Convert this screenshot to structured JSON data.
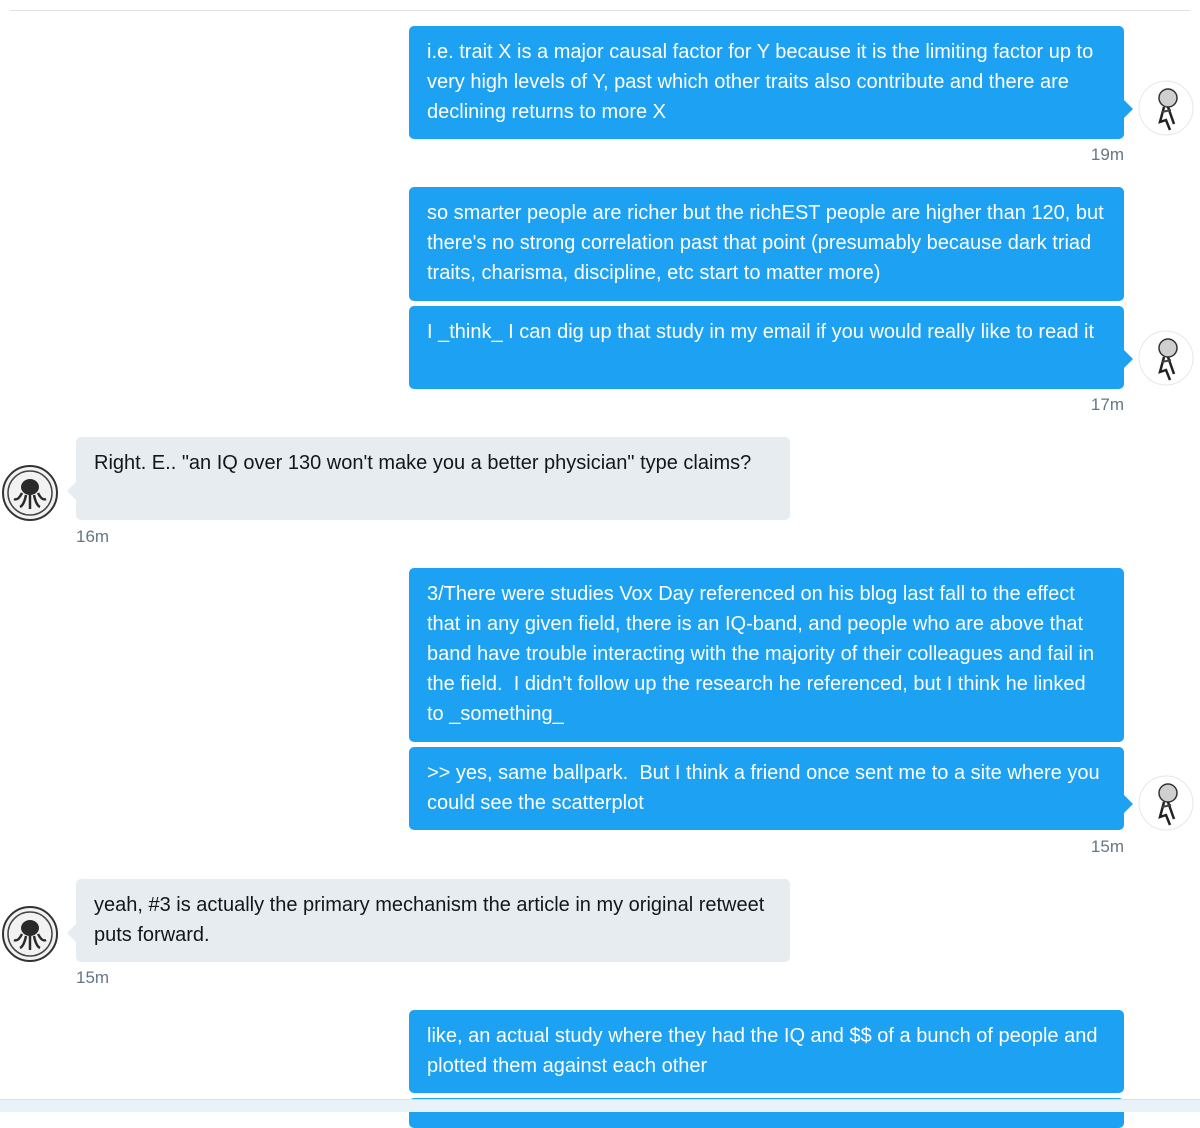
{
  "conversation": {
    "messages": [
      {
        "sender": "self",
        "text": "i.e. trait X is a major causal factor for Y because it is the limiting factor up to very high levels of Y, past which other traits also contribute and there are declining returns to more X"
      },
      {
        "sender": "self",
        "text": "so smarter people are richer but the richEST people are higher than 120, but there's no strong correlation past that point (presumably because dark triad traits, charisma, discipline, etc start to matter more)"
      },
      {
        "sender": "self",
        "text": "I _think_ I can dig up that study in my email if you would really like to read it"
      },
      {
        "sender": "other",
        "text": "Right. E.. \"an IQ over 130 won't make you a better physician\" type claims?"
      },
      {
        "sender": "self",
        "text": "3/There were studies Vox Day referenced on his blog last fall to the effect that in any given field, there is an IQ-band, and people who are above that band have trouble interacting with the majority of their colleagues and fail in the field.  I didn't follow up the research he referenced, but I think he linked to _something_"
      },
      {
        "sender": "self",
        "text": ">> yes, same ballpark.  But I think a friend once sent me to a site where you could see the scatterplot"
      },
      {
        "sender": "other",
        "text": "yeah, #3 is actually the primary mechanism the article in my original retweet puts forward."
      },
      {
        "sender": "self",
        "text": "like, an actual study where they had the IQ and $$ of a bunch of people and plotted them against each other"
      }
    ],
    "timestamps": [
      "19m",
      "17m",
      "16m",
      "15m",
      "15m"
    ],
    "avatars": {
      "self": "sketch-figure-avatar",
      "other": "octopus-emblem-avatar"
    }
  },
  "colors": {
    "outgoing_bubble": "#1da1f2",
    "incoming_bubble": "#e6ecf0",
    "timestamp": "#657786"
  }
}
